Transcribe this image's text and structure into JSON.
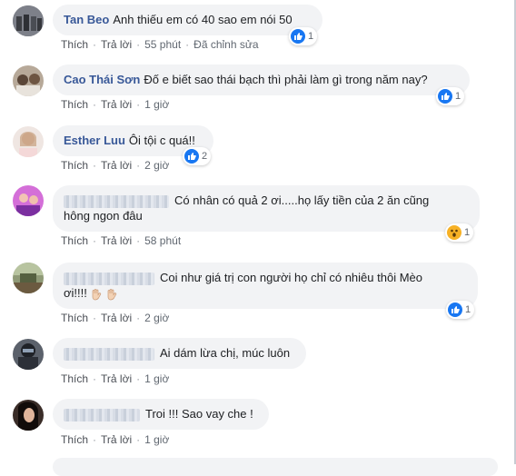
{
  "comments": [
    {
      "author": "Tan Beo",
      "text": "Anh thiếu em có 40 sao em nói 50",
      "text2": "",
      "actions": {
        "like": "Thích",
        "reply": "Trả lời",
        "time": "55 phút",
        "edited": "Đã chỉnh sửa"
      },
      "reaction": {
        "type": "like",
        "count": "1"
      },
      "avatar_color": "#6b6f78"
    },
    {
      "author": "Cao Thái Sơn",
      "text": "Đố e biết sao thái bạch thì phải làm gì trong năm nay?",
      "text2": "",
      "actions": {
        "like": "Thích",
        "reply": "Trả lời",
        "time": "1 giờ"
      },
      "reaction": {
        "type": "like",
        "count": "1"
      },
      "avatar_color": "#8a7d70"
    },
    {
      "author": "Esther Luu",
      "text": "Ôi tội c quá!!",
      "text2": "",
      "actions": {
        "like": "Thích",
        "reply": "Trả lời",
        "time": "2 giờ"
      },
      "reaction": {
        "type": "like",
        "count": "2"
      },
      "avatar_color": "#c9b3a8"
    },
    {
      "author": "",
      "text": "Có nhân có quả 2 ơi.....họ lấy tiền của 2 ăn cũng",
      "text2": "hông ngon đâu",
      "actions": {
        "like": "Thích",
        "reply": "Trả lời",
        "time": "58 phút"
      },
      "reaction": {
        "type": "wow",
        "count": "1"
      },
      "avatar_color": "#a95bc4"
    },
    {
      "author": "",
      "text": "Coi như giá trị con người họ chỉ có nhiêu thôi Mèo",
      "text2": "ơi!!!!",
      "actions": {
        "like": "Thích",
        "reply": "Trả lời",
        "time": "2 giờ"
      },
      "reaction": {
        "type": "like",
        "count": "1"
      },
      "avatar_color": "#6f7a55"
    },
    {
      "author": "",
      "text": "Ai dám lừa chị, múc luôn",
      "text2": "",
      "actions": {
        "like": "Thích",
        "reply": "Trả lời",
        "time": "1 giờ"
      },
      "reaction": null,
      "avatar_color": "#3a3f48"
    },
    {
      "author": "",
      "text": "Troi !!! Sao vay che !",
      "text2": "",
      "actions": {
        "like": "Thích",
        "reply": "Trả lời",
        "time": "1 giờ"
      },
      "reaction": null,
      "avatar_color": "#2b2422"
    }
  ],
  "icons": {
    "like": "thumbs-up-icon",
    "wow": "wow-face-icon",
    "hand": "raised-hand-icon"
  }
}
